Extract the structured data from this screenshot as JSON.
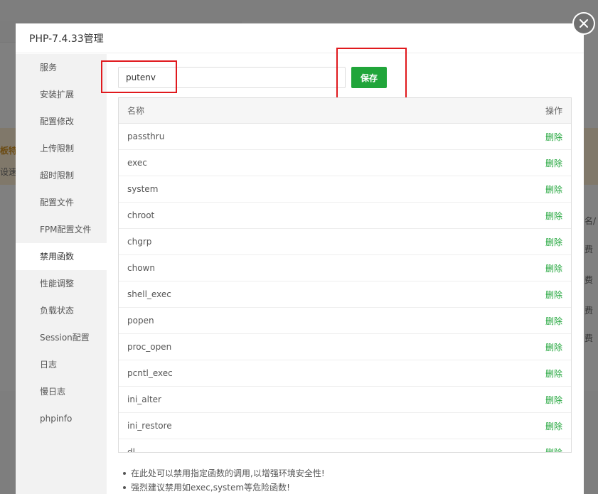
{
  "background": {
    "frag_1": "板特",
    "frag_2": "设速I",
    "frag_3": "名/",
    "frag_4": "费",
    "frag_5": "费",
    "frag_6": "费",
    "frag_7": "费"
  },
  "modal": {
    "title": "PHP-7.4.33管理"
  },
  "sidebar": {
    "items": [
      {
        "label": "服务"
      },
      {
        "label": "安装扩展"
      },
      {
        "label": "配置修改"
      },
      {
        "label": "上传限制"
      },
      {
        "label": "超时限制"
      },
      {
        "label": "配置文件"
      },
      {
        "label": "FPM配置文件"
      },
      {
        "label": "禁用函数"
      },
      {
        "label": "性能调整"
      },
      {
        "label": "负载状态"
      },
      {
        "label": "Session配置"
      },
      {
        "label": "日志"
      },
      {
        "label": "慢日志"
      },
      {
        "label": "phpinfo"
      }
    ],
    "active_index": 7
  },
  "form": {
    "input_value": "putenv",
    "save_label": "保存"
  },
  "table": {
    "header_name": "名称",
    "header_action": "操作",
    "rows": [
      {
        "name": "passthru",
        "action": "删除"
      },
      {
        "name": "exec",
        "action": "删除"
      },
      {
        "name": "system",
        "action": "删除"
      },
      {
        "name": "chroot",
        "action": "删除"
      },
      {
        "name": "chgrp",
        "action": "删除"
      },
      {
        "name": "chown",
        "action": "删除"
      },
      {
        "name": "shell_exec",
        "action": "删除"
      },
      {
        "name": "popen",
        "action": "删除"
      },
      {
        "name": "proc_open",
        "action": "删除"
      },
      {
        "name": "pcntl_exec",
        "action": "删除"
      },
      {
        "name": "ini_alter",
        "action": "删除"
      },
      {
        "name": "ini_restore",
        "action": "删除"
      },
      {
        "name": "dl",
        "action": "删除"
      }
    ]
  },
  "tips": [
    "在此处可以禁用指定函数的调用,以增强环境安全性!",
    "强烈建议禁用如exec,system等危险函数!"
  ],
  "colors": {
    "accent": "#20a53a",
    "highlight": "#e0191d"
  }
}
